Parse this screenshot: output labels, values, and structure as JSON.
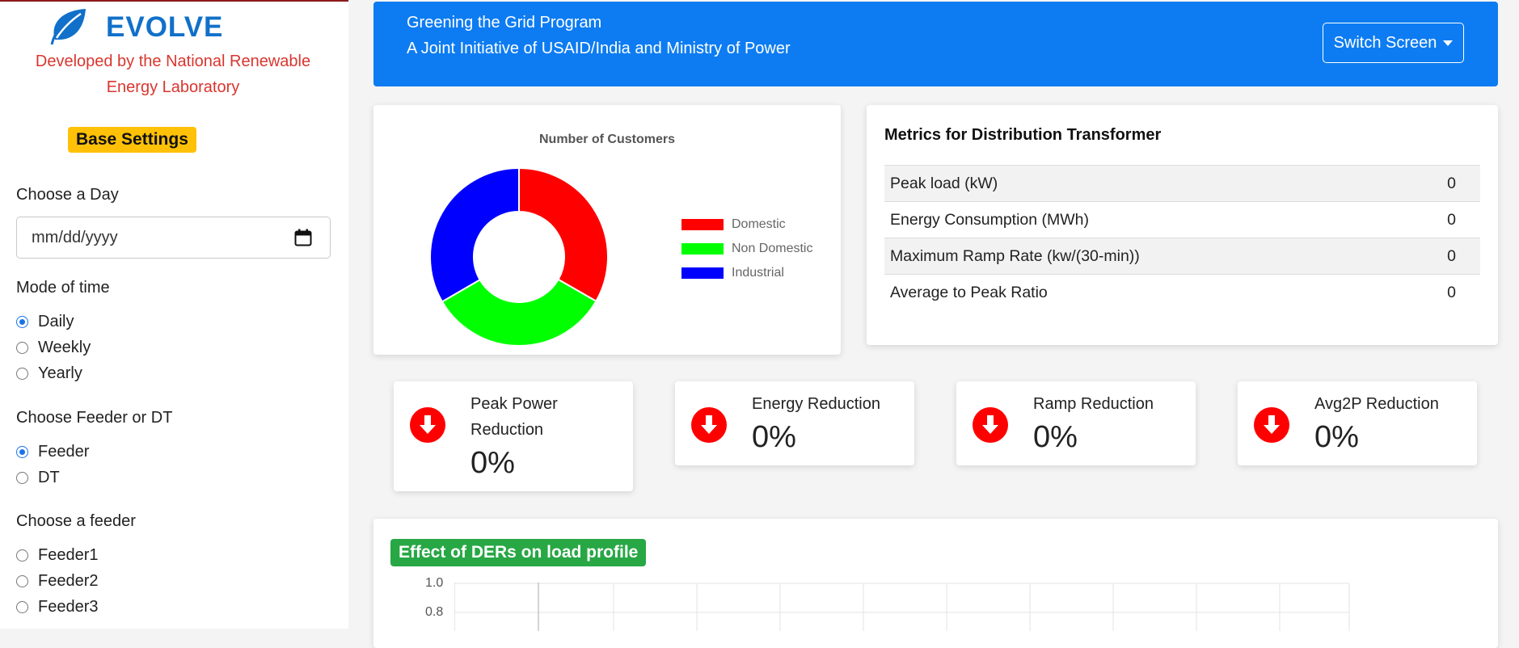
{
  "sidebar": {
    "brand": "EVOLVE",
    "developer": "Developed by the National Renewable Energy Laboratory",
    "base_settings": "Base Settings",
    "day_label": "Choose a Day",
    "day_placeholder": "mm/dd/yyyy",
    "mode_label": "Mode of time",
    "modes": [
      {
        "label": "Daily",
        "checked": true
      },
      {
        "label": "Weekly",
        "checked": false
      },
      {
        "label": "Yearly",
        "checked": false
      }
    ],
    "feeder_dt_label": "Choose Feeder or DT",
    "feeder_dt": [
      {
        "label": "Feeder",
        "checked": true
      },
      {
        "label": "DT",
        "checked": false
      }
    ],
    "feeder_label": "Choose a feeder",
    "feeders": [
      {
        "label": "Feeder1",
        "checked": false
      },
      {
        "label": "Feeder2",
        "checked": false
      },
      {
        "label": "Feeder3",
        "checked": false
      }
    ]
  },
  "header": {
    "line1": "Greening the Grid Program",
    "line2": "A Joint Initiative of USAID/India and Ministry of Power",
    "switch_screen": "Switch Screen"
  },
  "chart_data": {
    "type": "pie",
    "title": "Number of Customers",
    "categories": [
      "Domestic",
      "Non Domestic",
      "Industrial"
    ],
    "values": [
      33.3,
      33.3,
      33.4
    ],
    "colors": [
      "#ff0000",
      "#00ff00",
      "#0000ff"
    ],
    "legend": "right"
  },
  "metrics": {
    "title": "Metrics for Distribution Transformer",
    "rows": [
      {
        "label": "Peak load (kW)",
        "value": "0"
      },
      {
        "label": "Energy Consumption (MWh)",
        "value": "0"
      },
      {
        "label": "Maximum Ramp Rate (kw/(30-min))",
        "value": "0"
      },
      {
        "label": "Average to Peak Ratio",
        "value": "0"
      }
    ]
  },
  "kpis": [
    {
      "label": "Peak Power Reduction",
      "value": "0%"
    },
    {
      "label": "Energy Reduction",
      "value": "0%"
    },
    {
      "label": "Ramp Reduction",
      "value": "0%"
    },
    {
      "label": "Avg2P Reduction",
      "value": "0%"
    }
  ],
  "load_profile": {
    "title": "Effect of DERs on load profile",
    "y_ticks": [
      "1.0",
      "0.8"
    ]
  },
  "colors": {
    "banner": "#0d7cf2",
    "brand": "#1170c9",
    "developer_text": "#d9362f",
    "base_button": "#ffc107",
    "load_title": "#28a745",
    "kpi_icon": "#ff0000"
  },
  "icons": {
    "brand": "leaf-icon",
    "date": "calendar-icon",
    "kpi": "arrow-down-circle-icon"
  }
}
